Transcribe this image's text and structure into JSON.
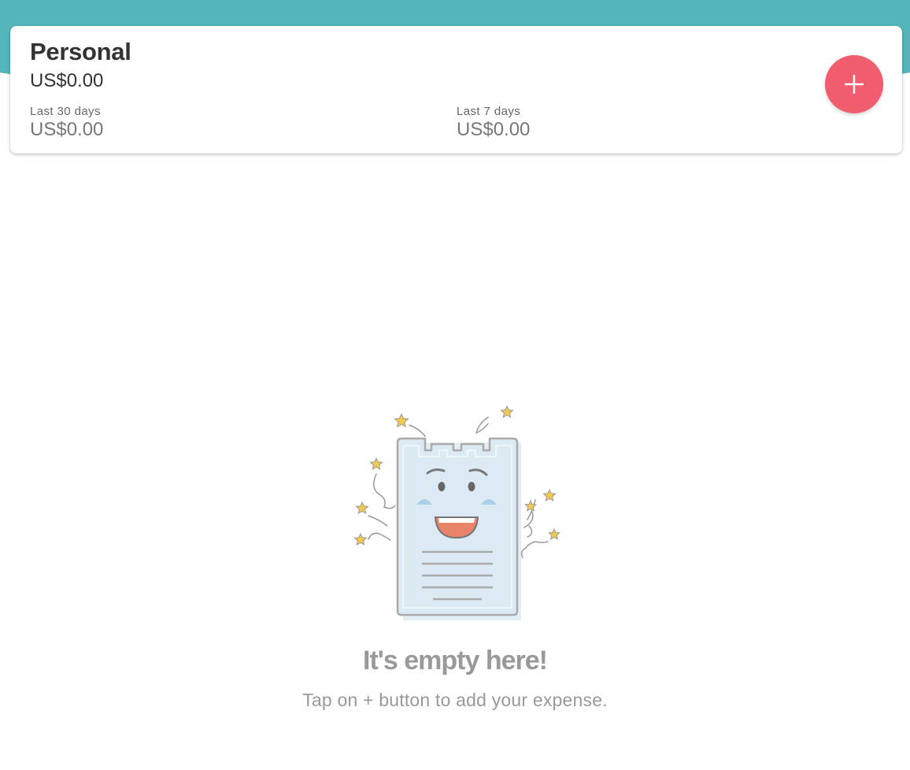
{
  "colors": {
    "header": "#54b5ba",
    "fab": "#ef5d6f",
    "receipt_fill": "#dcebf3",
    "mouth": "#ea8469",
    "star": "#f1c94f"
  },
  "account": {
    "name": "Personal",
    "total": "US$0.00",
    "stats": [
      {
        "label": "Last 30 days",
        "value": "US$0.00"
      },
      {
        "label": "Last 7 days",
        "value": "US$0.00"
      }
    ]
  },
  "add_button": {
    "icon": "plus-icon"
  },
  "empty_state": {
    "illustration": "happy-receipt-illustration",
    "title": "It's empty here!",
    "subtitle": "Tap on + button to add your expense."
  }
}
